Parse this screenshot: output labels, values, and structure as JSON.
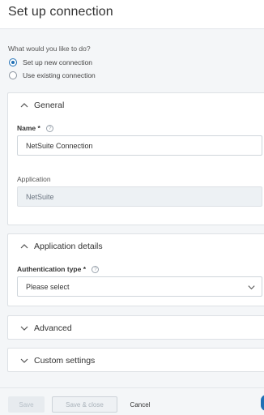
{
  "header": {
    "title": "Set up connection"
  },
  "intent": {
    "question": "What would you like to do?",
    "options": [
      {
        "label": "Set up new connection",
        "checked": true
      },
      {
        "label": "Use existing connection",
        "checked": false
      }
    ]
  },
  "general": {
    "title": "General",
    "expanded": true,
    "name_label": "Name",
    "name_required": "*",
    "name_value": "NetSuite Connection",
    "application_label": "Application",
    "application_value": "NetSuite"
  },
  "application_details": {
    "title": "Application details",
    "expanded": true,
    "auth_label": "Authentication type",
    "auth_required": "*",
    "auth_value": "Please select"
  },
  "advanced": {
    "title": "Advanced",
    "expanded": false
  },
  "custom_settings": {
    "title": "Custom settings",
    "expanded": false
  },
  "footer": {
    "save_label": "Save",
    "save_close_label": "Save & close",
    "cancel_label": "Cancel"
  },
  "colors": {
    "accent": "#1f6fb5",
    "background": "#f4f6f8",
    "panel": "#ffffff"
  },
  "icons": {
    "help": "question-circle-icon",
    "collapse": "chevron-up-icon",
    "expand": "chevron-down-icon"
  }
}
